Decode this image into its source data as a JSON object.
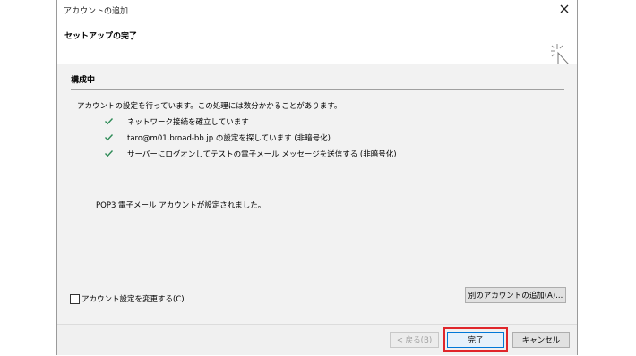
{
  "window": {
    "title": "アカウントの追加",
    "close_glyph": "✕"
  },
  "header": {
    "title": "セットアップの完了"
  },
  "section": {
    "title": "構成中"
  },
  "description": "アカウントの設定を行っています。この処理には数分かかることがあります。",
  "steps": [
    {
      "text": "ネットワーク接続を確立しています",
      "status": "done"
    },
    {
      "text": "taro@m01.broad-bb.jp の設定を探しています (非暗号化)",
      "status": "done"
    },
    {
      "text": "サーバーにログオンしてテストの電子メール メッセージを送信する (非暗号化)",
      "status": "done"
    }
  ],
  "result_message": "POP3 電子メール アカウントが設定されました。",
  "change_settings": {
    "label": "アカウント設定を変更する(C)",
    "checked": false
  },
  "buttons": {
    "add_another": "別のアカウントの追加(A)...",
    "back": "< 戻る(B)",
    "finish": "完了",
    "cancel": "キャンセル"
  },
  "colors": {
    "check": "#2e8b57",
    "highlight": "#e0262b",
    "accent": "#0078d7"
  }
}
